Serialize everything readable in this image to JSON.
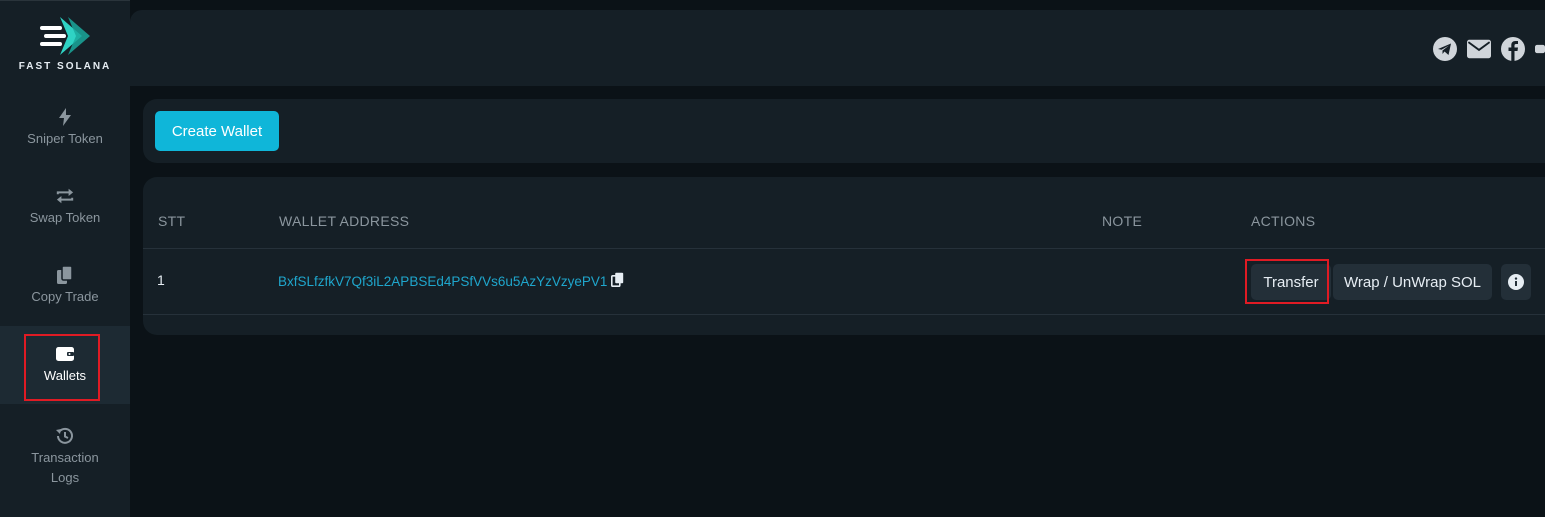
{
  "brand": {
    "name": "FAST SOLANA"
  },
  "sidebar": {
    "items": [
      {
        "label": "Sniper Token",
        "icon": "bolt-icon"
      },
      {
        "label": "Swap Token",
        "icon": "swap-icon"
      },
      {
        "label": "Copy Trade",
        "icon": "copy-icon"
      },
      {
        "label": "Wallets",
        "icon": "wallet-icon",
        "active": true
      },
      {
        "label": "Transaction Logs",
        "icon": "history-icon"
      }
    ]
  },
  "topbar": {
    "icons": [
      "telegram-icon",
      "mail-icon",
      "facebook-icon",
      "youtube-icon"
    ]
  },
  "actions": {
    "create_wallet_label": "Create Wallet"
  },
  "table": {
    "headers": [
      "STT",
      "WALLET ADDRESS",
      "NOTE",
      "ACTIONS"
    ],
    "rows": [
      {
        "stt": "1",
        "address": "BxfSLfzfkV7Qf3iL2APBSEd4PSfVVs6u5AzYzVzyePV1",
        "note": "",
        "transfer_label": "Transfer",
        "wrap_label": "Wrap / UnWrap SOL"
      }
    ]
  },
  "colors": {
    "accent": "#0fb6d9",
    "highlight": "#e01b24",
    "panel": "#151f26",
    "background": "#0b1217"
  }
}
